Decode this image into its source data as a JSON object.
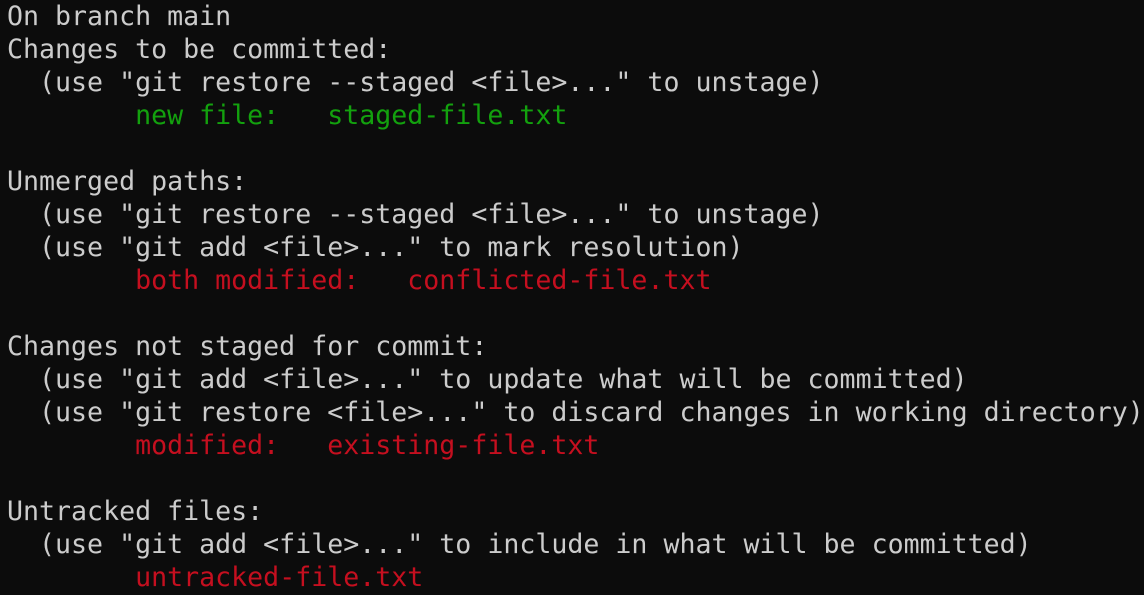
{
  "colors": {
    "background": "#0c0c0c",
    "foreground": "#cccccc",
    "green": "#13a10e",
    "red": "#c50f1f"
  },
  "lines": [
    {
      "text": "On branch main"
    },
    {
      "text": "Changes to be committed:"
    },
    {
      "text": "  (use \"git restore --staged <file>...\" to unstage)"
    },
    {
      "indent": "        ",
      "text": "new file:   staged-file.txt",
      "color": "green"
    },
    {
      "text": ""
    },
    {
      "text": "Unmerged paths:"
    },
    {
      "text": "  (use \"git restore --staged <file>...\" to unstage)"
    },
    {
      "text": "  (use \"git add <file>...\" to mark resolution)"
    },
    {
      "indent": "        ",
      "text": "both modified:   conflicted-file.txt",
      "color": "red"
    },
    {
      "text": ""
    },
    {
      "text": "Changes not staged for commit:"
    },
    {
      "text": "  (use \"git add <file>...\" to update what will be committed)"
    },
    {
      "text": "  (use \"git restore <file>...\" to discard changes in working directory)"
    },
    {
      "indent": "        ",
      "text": "modified:   existing-file.txt",
      "color": "red"
    },
    {
      "text": ""
    },
    {
      "text": "Untracked files:"
    },
    {
      "text": "  (use \"git add <file>...\" to include in what will be committed)"
    },
    {
      "indent": "        ",
      "text": "untracked-file.txt",
      "color": "red"
    }
  ]
}
